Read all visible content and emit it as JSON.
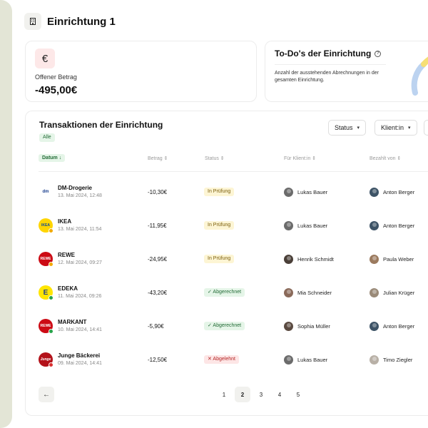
{
  "header": {
    "title": "Einrichtung 1",
    "icon": "building-icon"
  },
  "balance": {
    "currency_symbol": "€",
    "label": "Offener Betrag",
    "amount": "-495,00€"
  },
  "todo": {
    "title": "To-Do's der Einrichtung",
    "help": "?",
    "description": "Anzahl der ausstehenden Abrechnungen in der gesamten Einrichtung."
  },
  "transactions": {
    "title": "Transaktionen der Einrichtung",
    "filter_pill": "Alle",
    "filters": {
      "status": "Status",
      "klient": "Klient:in"
    },
    "columns": {
      "datum": "Datum ↓",
      "betrag": "Betrag ⇕",
      "status": "Status ⇕",
      "klient": "Für Klient:in ⇕",
      "payer": "Bezahlt von ⇕"
    },
    "rows": [
      {
        "merchant": "DM-Drogerie",
        "date": "13. Mai 2024, 12:48",
        "amount": "-10,30€",
        "status": "In Prüfung",
        "klient": "Lukas Bauer",
        "payer": "Anton Berger"
      },
      {
        "merchant": "IKEA",
        "date": "13. Mai 2024, 11:54",
        "amount": "-11,95€",
        "status": "In Prüfung",
        "klient": "Lukas Bauer",
        "payer": "Anton Berger"
      },
      {
        "merchant": "REWE",
        "date": "12. Mai 2024, 09:27",
        "amount": "-24,95€",
        "status": "In Prüfung",
        "klient": "Henrik Schmidt",
        "payer": "Paula Weber"
      },
      {
        "merchant": "EDEKA",
        "date": "11. Mai 2024, 09:26",
        "amount": "-43,20€",
        "status": "✓ Abgerechnet",
        "klient": "Mia Schneider",
        "payer": "Julian Krüger"
      },
      {
        "merchant": "MARKANT",
        "date": "10. Mai 2024, 14:41",
        "amount": "-5,90€",
        "status": "✓ Abgerechnet",
        "klient": "Sophia Müller",
        "payer": "Anton Berger"
      },
      {
        "merchant": "Junge Bäckerei",
        "date": "09. Mai 2024, 14:41",
        "amount": "-12,50€",
        "status": "✕ Abgelehnt",
        "klient": "Lukas Bauer",
        "payer": "Timo Ziegler"
      }
    ],
    "logos": [
      "dm",
      "IKEA",
      "REWE",
      "E",
      "REWE",
      "Junge"
    ],
    "pagination": {
      "back": "←",
      "pages": [
        "1",
        "2",
        "3",
        "4",
        "5"
      ],
      "active": "2"
    }
  },
  "colors": {
    "pending": "#fdf5d4",
    "settled": "#e5f5e8",
    "rejected": "#fde6e6",
    "rail": "#e3e5d6"
  }
}
